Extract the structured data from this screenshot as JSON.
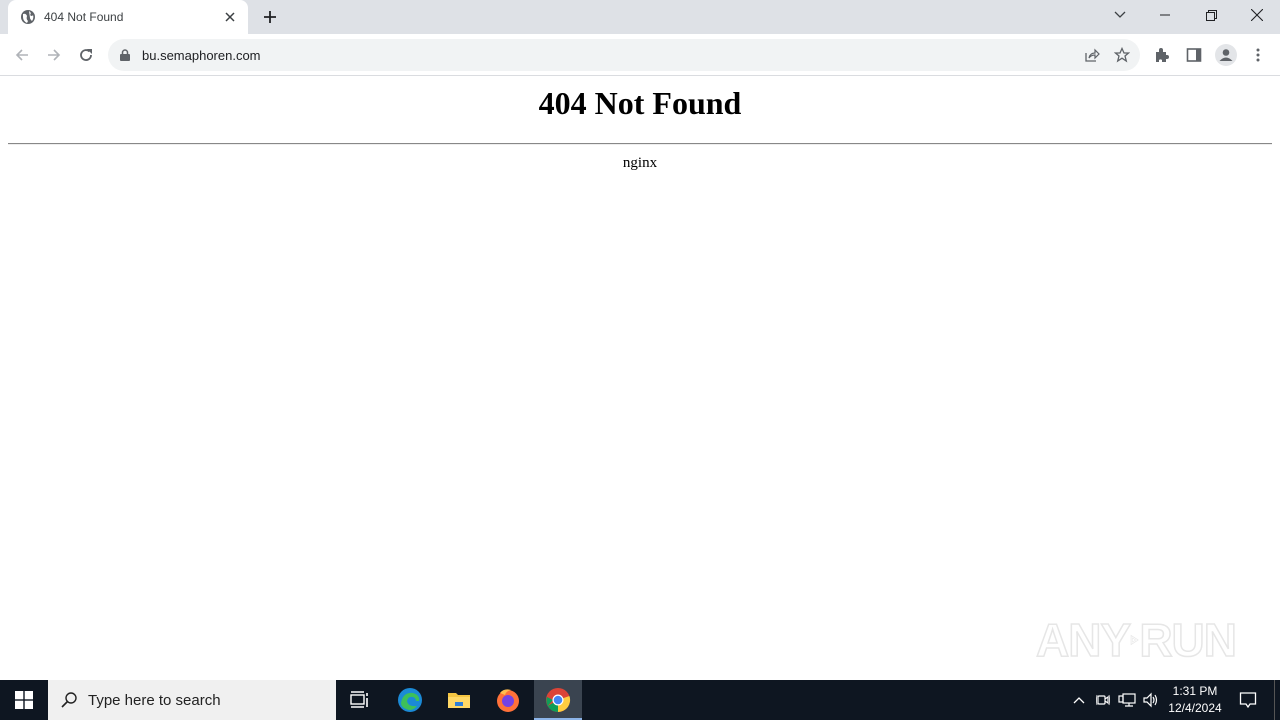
{
  "browser": {
    "tab": {
      "title": "404 Not Found",
      "favicon": "globe-icon"
    },
    "address_bar": {
      "url": "bu.semaphoren.com",
      "security_icon": "lock-icon"
    },
    "toolbar_icons": [
      "back-icon",
      "forward-icon",
      "reload-icon",
      "share-icon",
      "bookmark-star-icon",
      "extensions-icon",
      "side-panel-icon",
      "profile-icon",
      "menu-icon"
    ],
    "window_controls": [
      "tab-search-icon",
      "minimize-icon",
      "restore-icon",
      "close-icon"
    ]
  },
  "page": {
    "heading": "404 Not Found",
    "server": "nginx"
  },
  "watermark": {
    "text_left": "ANY",
    "text_right": "RUN"
  },
  "taskbar": {
    "search_placeholder": "Type here to search",
    "apps": [
      "task-view",
      "edge",
      "file-explorer",
      "firefox",
      "chrome"
    ],
    "active_app": "chrome",
    "clock": {
      "time": "1:31 PM",
      "date": "12/4/2024"
    }
  },
  "colors": {
    "tabstrip_bg": "#dee1e6",
    "omnibox_bg": "#f1f3f4",
    "taskbar_bg": "#0e1621",
    "taskbar_active": "#3a4450"
  }
}
